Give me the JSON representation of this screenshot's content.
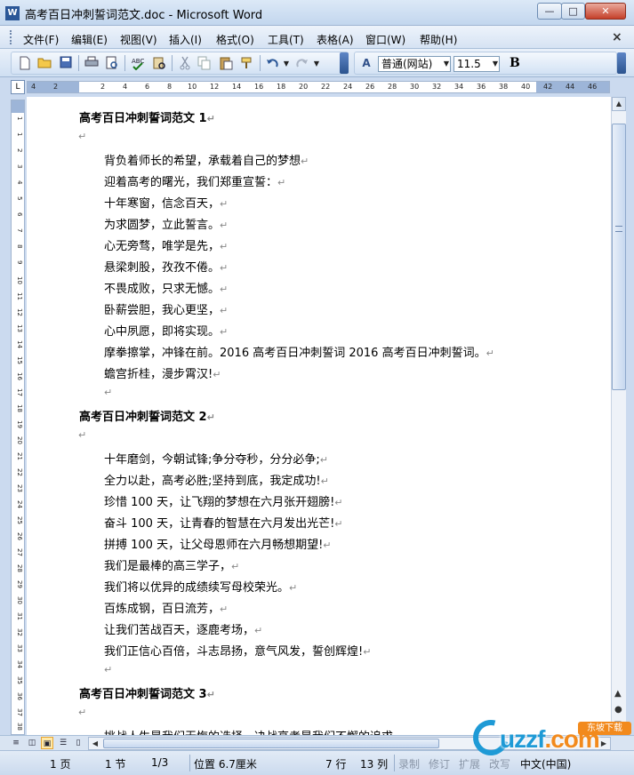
{
  "window": {
    "title": "高考百日冲刺誓词范文.doc - Microsoft Word",
    "app_icon": "W",
    "controls": {
      "minimize": "—",
      "maximize": "□",
      "close": "✕"
    }
  },
  "menu": {
    "items": [
      "文件(F)",
      "编辑(E)",
      "视图(V)",
      "插入(I)",
      "格式(O)",
      "工具(T)",
      "表格(A)",
      "窗口(W)",
      "帮助(H)"
    ],
    "doc_close": "×"
  },
  "toolbar": {
    "icons": [
      "new-icon",
      "open-icon",
      "save-icon",
      "print-icon",
      "print-preview-icon",
      "spelling-icon",
      "research-icon",
      "cut-icon",
      "copy-icon",
      "paste-icon",
      "format-painter-icon",
      "undo-icon",
      "redo-icon"
    ],
    "style_value": "普通(网站)",
    "font_size": "11.5",
    "bold_label": "B",
    "styles_icon_label": "A"
  },
  "ruler": {
    "corner": "L",
    "numbers": [
      "4",
      "2",
      "2",
      "4",
      "6",
      "8",
      "10",
      "12",
      "14",
      "16",
      "18",
      "20",
      "22",
      "24",
      "26",
      "28",
      "30",
      "32",
      "34",
      "36",
      "38",
      "40",
      "42",
      "44",
      "46"
    ]
  },
  "vruler": {
    "numbers": [
      "1",
      "1",
      "2",
      "3",
      "4",
      "5",
      "6",
      "7",
      "8",
      "9",
      "10",
      "11",
      "12",
      "13",
      "14",
      "15",
      "16",
      "17",
      "18",
      "19",
      "20",
      "21",
      "22",
      "23",
      "24",
      "25",
      "26",
      "27",
      "28",
      "29",
      "30",
      "31",
      "32",
      "33",
      "34",
      "35",
      "36",
      "37",
      "38"
    ]
  },
  "document": {
    "lines": [
      {
        "text": "高考百日冲刺誓词范文 1",
        "kind": "heading"
      },
      {
        "text": "",
        "kind": "empty"
      },
      {
        "text": "背负着师长的希望，承载着自己的梦想",
        "kind": "body"
      },
      {
        "text": "迎着高考的曙光，我们郑重宣誓：",
        "kind": "body"
      },
      {
        "text": "十年寒窗，信念百天，",
        "kind": "body"
      },
      {
        "text": "为求圆梦，立此誓言。",
        "kind": "body"
      },
      {
        "text": "心无旁骛，唯学是先，",
        "kind": "body"
      },
      {
        "text": "悬梁刺股，孜孜不倦。",
        "kind": "body"
      },
      {
        "text": "不畏成败，只求无憾。",
        "kind": "body"
      },
      {
        "text": "卧薪尝胆，我心更坚，",
        "kind": "body"
      },
      {
        "text": "心中夙愿，即将实现。",
        "kind": "body"
      },
      {
        "text": "摩拳擦掌，冲锋在前。2016 高考百日冲刺誓词 2016 高考百日冲刺誓词。",
        "kind": "body"
      },
      {
        "text": "蟾宫折桂，漫步霄汉!",
        "kind": "body"
      },
      {
        "text": "",
        "kind": "empty-indent"
      },
      {
        "text": "高考百日冲刺誓词范文 2",
        "kind": "heading"
      },
      {
        "text": "",
        "kind": "empty"
      },
      {
        "text": "十年磨剑，今朝试锋;争分夺秒，分分必争;",
        "kind": "body"
      },
      {
        "text": "全力以赴，高考必胜;坚持到底，我定成功!",
        "kind": "body"
      },
      {
        "text": "珍惜 100 天，让飞翔的梦想在六月张开翅膀!",
        "kind": "body"
      },
      {
        "text": "奋斗 100 天，让青春的智慧在六月发出光芒!",
        "kind": "body"
      },
      {
        "text": "拼搏 100 天，让父母恩师在六月畅想期望!",
        "kind": "body"
      },
      {
        "text": "我们是最棒的高三学子，",
        "kind": "body"
      },
      {
        "text": "我们将以优异的成绩续写母校荣光。",
        "kind": "body"
      },
      {
        "text": "百炼成钢，百日流芳，",
        "kind": "body"
      },
      {
        "text": "让我们苦战百天，逐鹿考场，",
        "kind": "body"
      },
      {
        "text": "我们正信心百倍，斗志昂扬，意气风发，誓创辉煌!",
        "kind": "body"
      },
      {
        "text": "",
        "kind": "empty-indent"
      },
      {
        "text": "高考百日冲刺誓词范文 3",
        "kind": "heading"
      },
      {
        "text": "",
        "kind": "empty"
      },
      {
        "text": "挑战人生是我们无悔的选择，决战高考是我们不懈的追求。",
        "kind": "body-cut"
      }
    ],
    "paragraph_mark": "↵"
  },
  "statusbar": {
    "page": "1 页",
    "section": "1 节",
    "page_of": "1/3",
    "position": "位置 6.7厘米",
    "line": "7 行",
    "column": "13 列",
    "rec": "录制",
    "trk": "修订",
    "ext": "扩展",
    "ovr": "改写",
    "language": "中文(中国)"
  },
  "watermark": {
    "brand": "uzzf",
    "tld": ".com",
    "badge": "东坡下载"
  }
}
